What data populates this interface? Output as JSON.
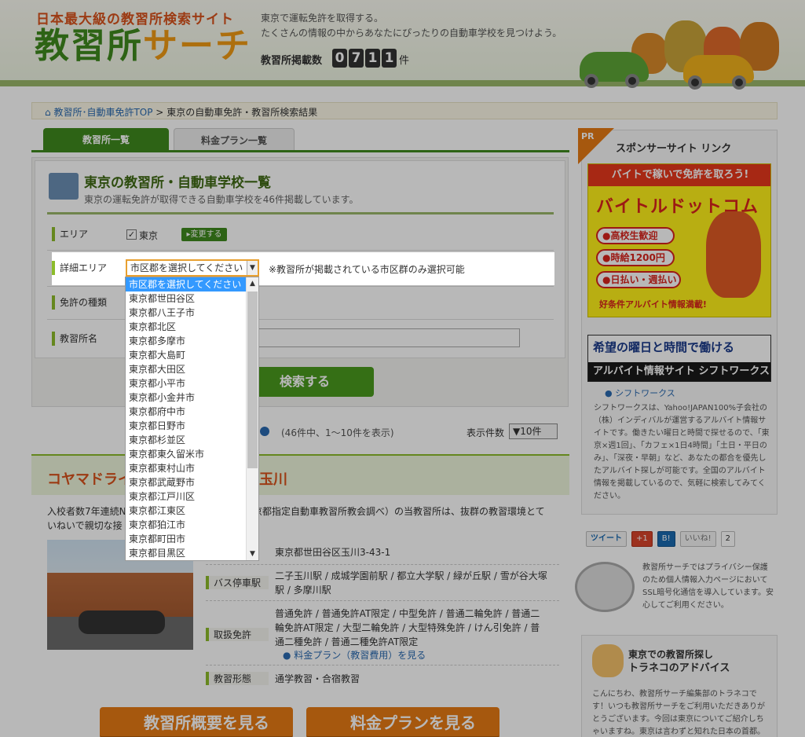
{
  "header": {
    "catch": "日本最大級の教習所検索サイト",
    "logo_main": "教習所",
    "logo_accent": "サーチ",
    "intro1": "東京で運転免許を取得する。",
    "intro2": "たくさんの情報の中からあなたにぴったりの自動車学校を見つけよう。",
    "count_label": "教習所掲載数",
    "count_digits": [
      "0",
      "7",
      "1",
      "1"
    ],
    "count_unit": "件"
  },
  "breadcrumb": {
    "home": "教習所･自動車免許TOP",
    "sep": ">",
    "current": "東京の自動車免許・教習所検索結果"
  },
  "tabs": [
    "教習所一覧",
    "料金プラン一覧"
  ],
  "search": {
    "title": "東京の教習所・自動車学校一覧",
    "subtitle": "東京の運転免許が取得できる自動車学校を46件掲載しています。",
    "area_label": "エリア",
    "area_value": "東京",
    "area_checked": "✓",
    "change_button": "▸変更する",
    "detail_label": "詳細エリア",
    "detail_selected": "市区郡を選択してください",
    "detail_note": "※教習所が掲載されている市区群のみ選択可能",
    "license_label": "免許の種類",
    "name_label": "教習所名",
    "search_button": "検索する"
  },
  "dropdown_options": [
    "市区郡を選択してください",
    "東京都世田谷区",
    "東京都八王子市",
    "東京都北区",
    "東京都多摩市",
    "東京都大島町",
    "東京都大田区",
    "東京都小平市",
    "東京都小金井市",
    "東京都府中市",
    "東京都日野市",
    "東京都杉並区",
    "東京都東久留米市",
    "東京都東村山市",
    "東京都武蔵野市",
    "東京都江戸川区",
    "東京都江東区",
    "東京都狛江市",
    "東京都町田市",
    "東京都目黒区"
  ],
  "results": {
    "paging": "(46件中、1〜10件を表示)",
    "per_page_label": "表示件数",
    "per_page_value": "▼10件"
  },
  "school": {
    "name_left": "コヤマドライ",
    "name_right": "玉川",
    "desc1": "入校者数7年連続N",
    "desc1b": "京都指定自動車教習所教会調べ）の当教習所は、抜群の教習環境とて",
    "desc2": "いねいで親切な接",
    "address": "東京都世田谷区玉川3-43-1",
    "bus_label": "バス停車駅",
    "bus_value1": "二子玉川駅 / 成城学園前駅 / 都立大学駅 / 緑が丘駅 / 雪が谷大塚",
    "bus_value2": "駅 / 多摩川駅",
    "license_label": "取扱免許",
    "license_lines": [
      "普通免許 / 普通免許AT限定 / 中型免許 / 普通二輪免許 / 普通二",
      "輪免許AT限定 / 大型二輪免許 / 大型特殊免許 / けん引免許 / 普",
      "通二種免許 / 普通二種免許AT限定"
    ],
    "plan_link": "料金プラン（教習費用）を見る",
    "form_label": "教習形態",
    "form_value": "通学教習・合宿教習",
    "btn_overview": "教習所概要を見る",
    "btn_plan": "料金プランを見る"
  },
  "sidebar": {
    "pr": "PR",
    "title": "スポンサーサイト リンク",
    "ad1_top": "バイトで稼いで免許を取ろう!",
    "ad1_logo": "バイトルドットコム",
    "ad1_tags": [
      "●高校生歓迎",
      "●時給1200円",
      "●日払い・週払い"
    ],
    "ad1_foot": "好条件アルバイト情報満載!",
    "ad2_top": "希望の曜日と時間で働ける",
    "ad2_bottom": "アルバイト情報サイト シフトワークス",
    "ad2_link": "シフトワークス",
    "ad2_text": "シフトワークスは、Yahoo!JAPAN100%子会社の（株）インディバルが運営するアルバイト情報サイトです。働きたい曜日と時間で探せるので、「東京×週1回」、「カフェ×1日4時間」「土日・平日のみ」、「深夜・早朝」など、あなたの都合を優先したアルバイト探しが可能です。全国のアルバイト情報を掲載しているので、気軽に検索してみてください。",
    "social": [
      "ツイート",
      "+1",
      "B!",
      "いいね!",
      "2"
    ],
    "ssl_text": "教習所サーチではプライバシー保護のため個人情報入力ページにおいてSSL暗号化通信を導入しています。安心してご利用ください。",
    "adv_title1": "東京での教習所探し",
    "adv_title2": "トラネコのアドバイス",
    "adv_text": "こんにちわ、教習所サーチ編集部のトラネコです！いつも教習所サーチをご利用いただきありがとうございます。今回は東京についてご紹介しちゃいますね。東京は言わずと知れた日本の首都。国"
  }
}
